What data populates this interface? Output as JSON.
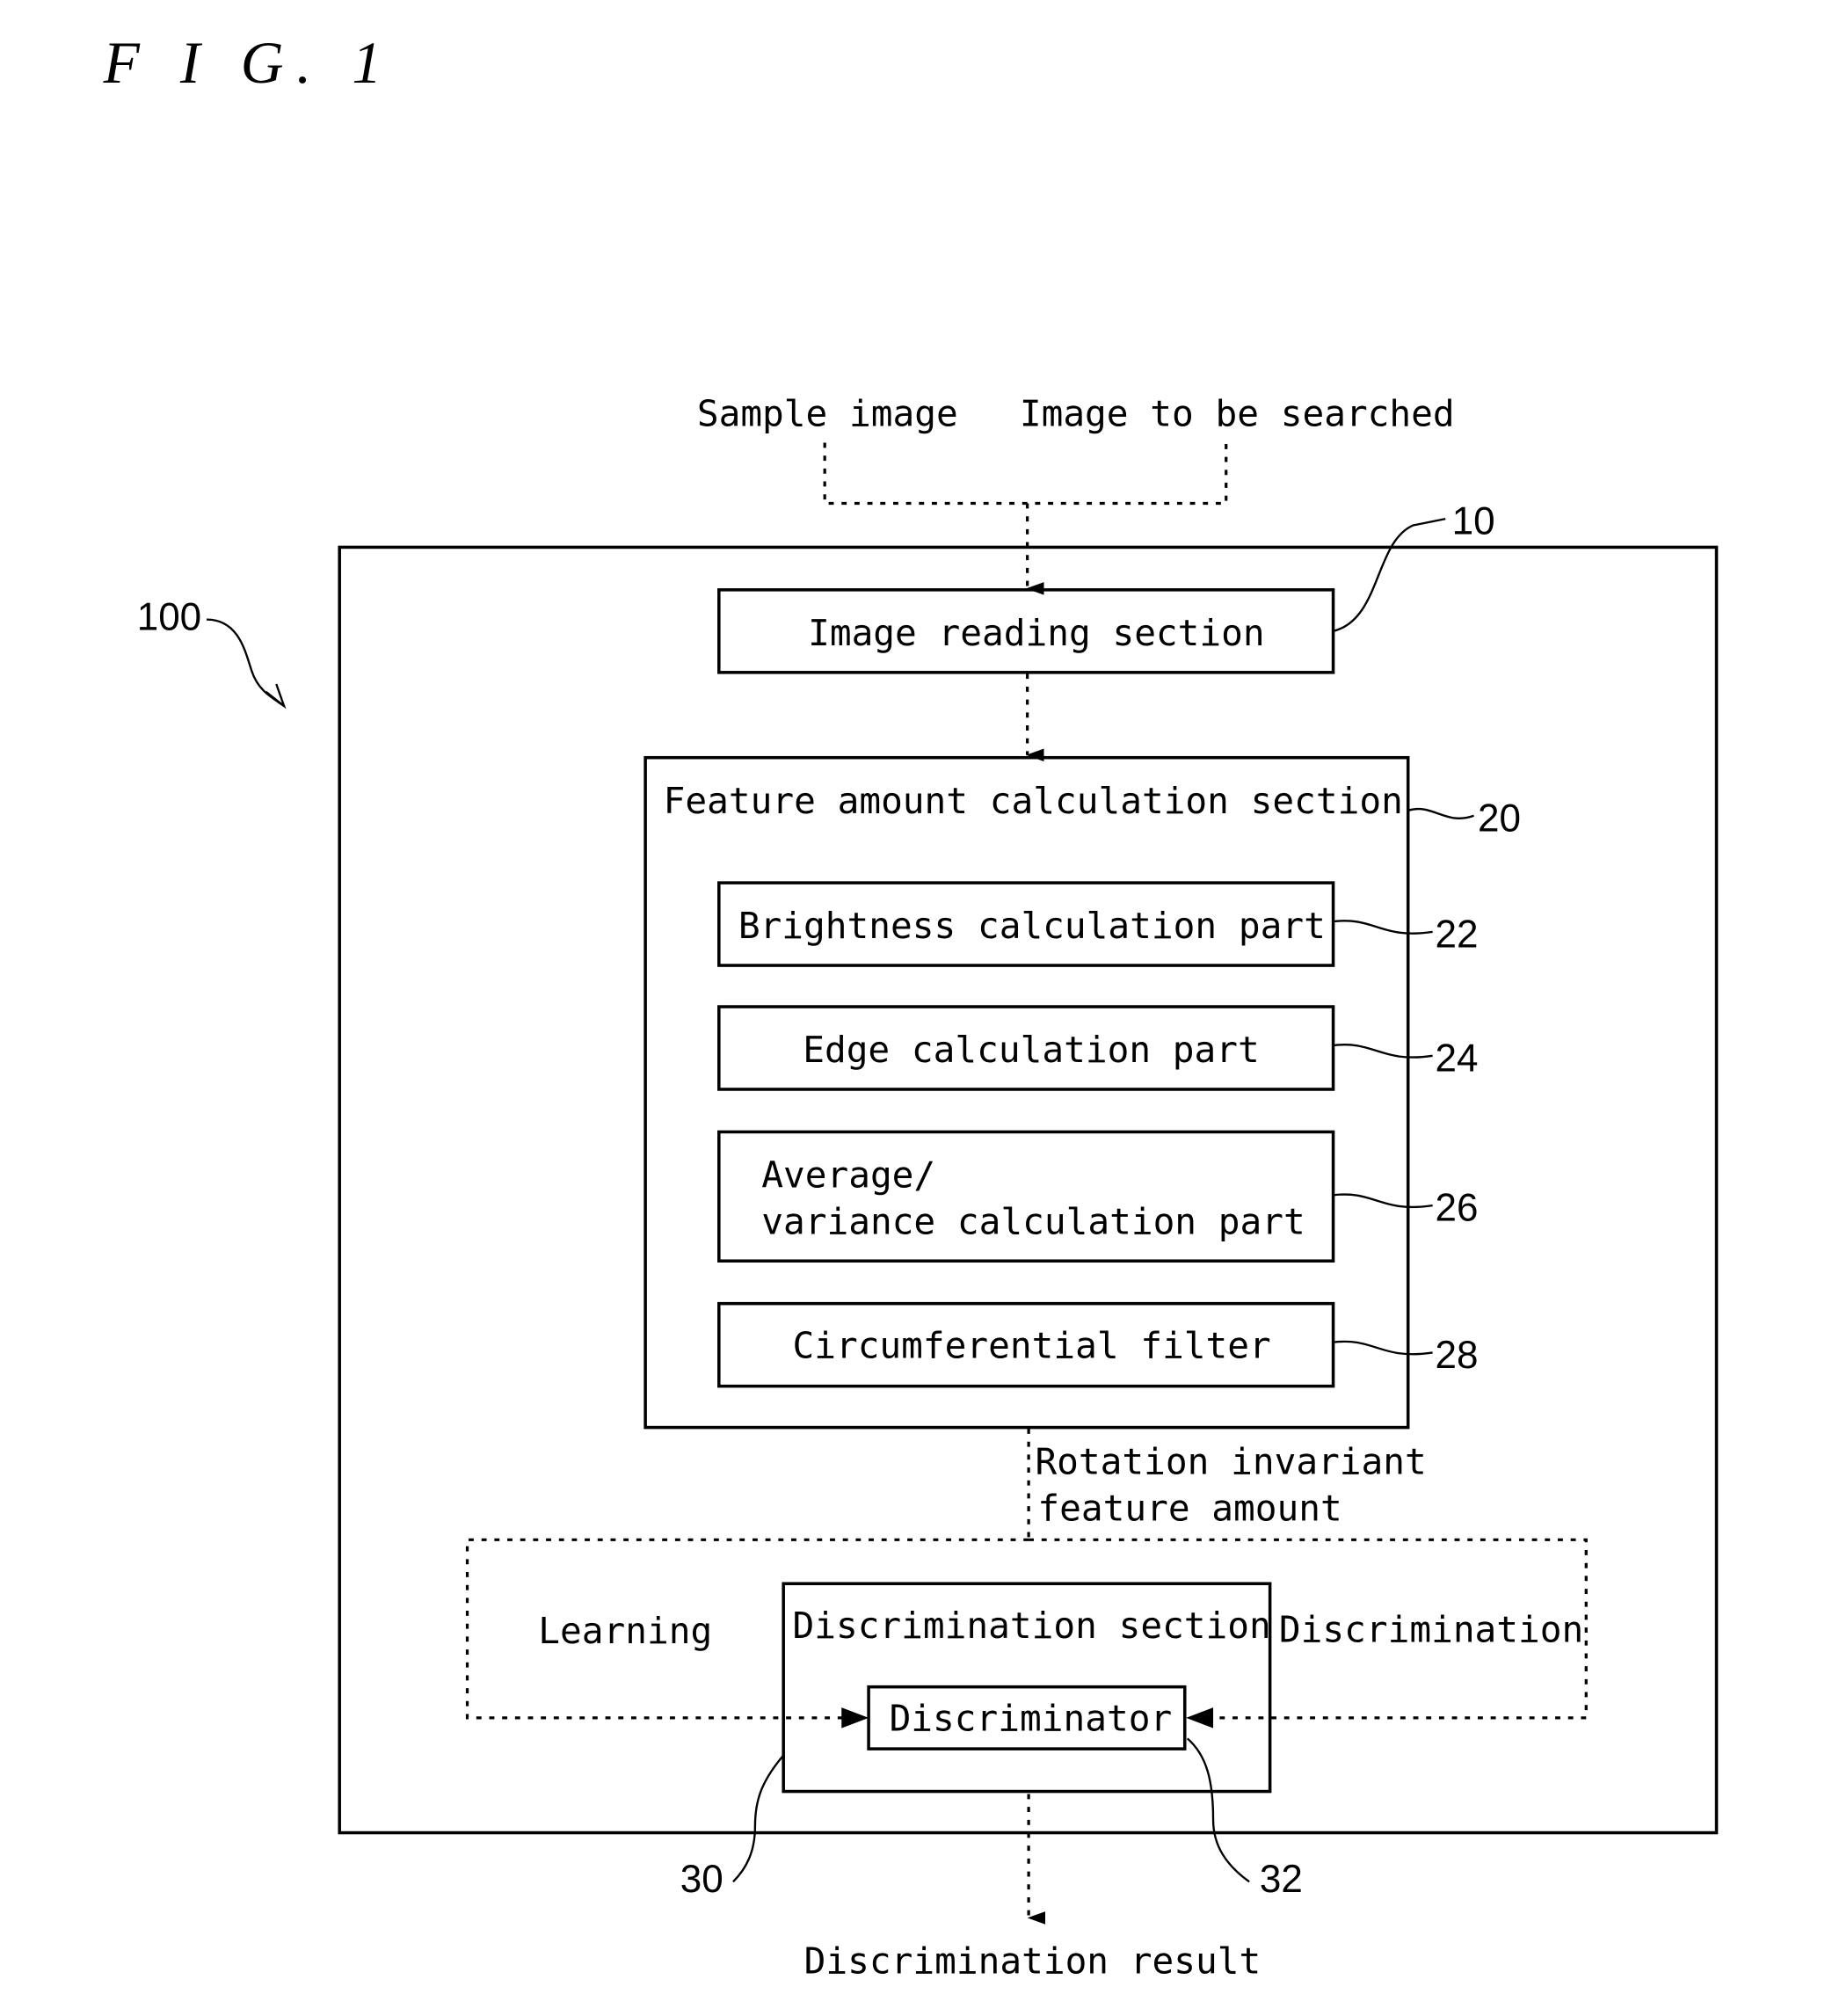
{
  "figure": {
    "title": "F I G. 1"
  },
  "inputs": {
    "sample_image": "Sample image",
    "image_to_search": "Image to be searched"
  },
  "system": {
    "ref": "100"
  },
  "blocks": {
    "image_reading": {
      "label": "Image reading section",
      "ref": "10"
    },
    "feature_calc": {
      "label": "Feature amount calculation section",
      "ref": "20"
    },
    "brightness": {
      "label": "Brightness calculation part",
      "ref": "22"
    },
    "edge": {
      "label": "Edge calculation part",
      "ref": "24"
    },
    "avg_var": {
      "label_line1": "Average/",
      "label_line2": "variance calculation part",
      "ref": "26"
    },
    "circ_filter": {
      "label": "Circumferential filter",
      "ref": "28"
    },
    "discrimination_section": {
      "label": "Discrimination section",
      "ref": "30"
    },
    "discriminator": {
      "label": "Discriminator",
      "ref": "32"
    }
  },
  "flows": {
    "feature_line1": "Rotation invariant",
    "feature_line2": "feature amount",
    "learning": "Learning",
    "discrimination": "Discrimination",
    "result": "Discrimination result"
  }
}
